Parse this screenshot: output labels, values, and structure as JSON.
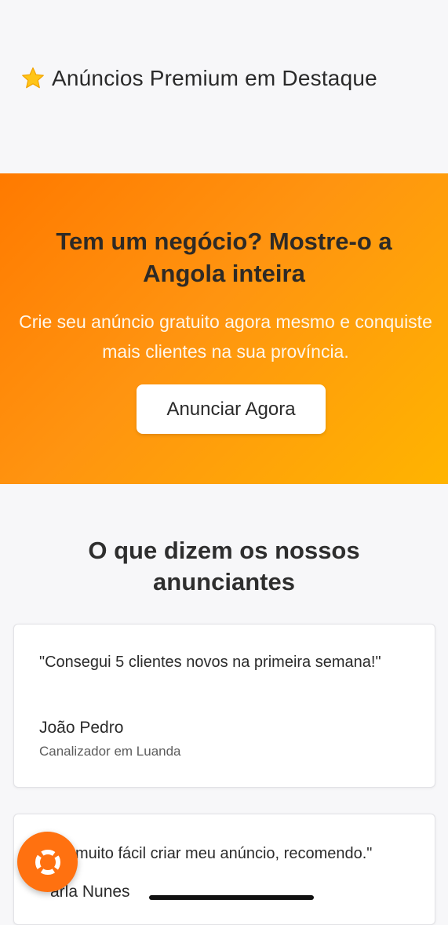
{
  "premium": {
    "icon": "star-icon",
    "title": "Anúncios Premium em Destaque"
  },
  "promo": {
    "headline": "Tem um negócio? Mostre-o a Angola inteira",
    "subtext": "Crie seu anúncio gratuito agora mesmo e conquiste mais clientes na sua província.",
    "cta_label": "Anunciar Agora"
  },
  "testimonials": {
    "title": "O que dizem os nossos anunciantes",
    "items": [
      {
        "quote": "\"Consegui 5 clientes novos na primeira semana!\"",
        "author": "João Pedro",
        "role": "Canalizador em Luanda"
      },
      {
        "quote": "muito fácil criar meu anúncio, recomendo.\"",
        "author": "arla Nunes"
      }
    ]
  },
  "fab": {
    "icon": "lifebuoy-icon"
  },
  "colors": {
    "accent": "#ff7a00",
    "accent_end": "#ffb400",
    "fab": "#ff7110",
    "background": "#f7f7f9"
  }
}
